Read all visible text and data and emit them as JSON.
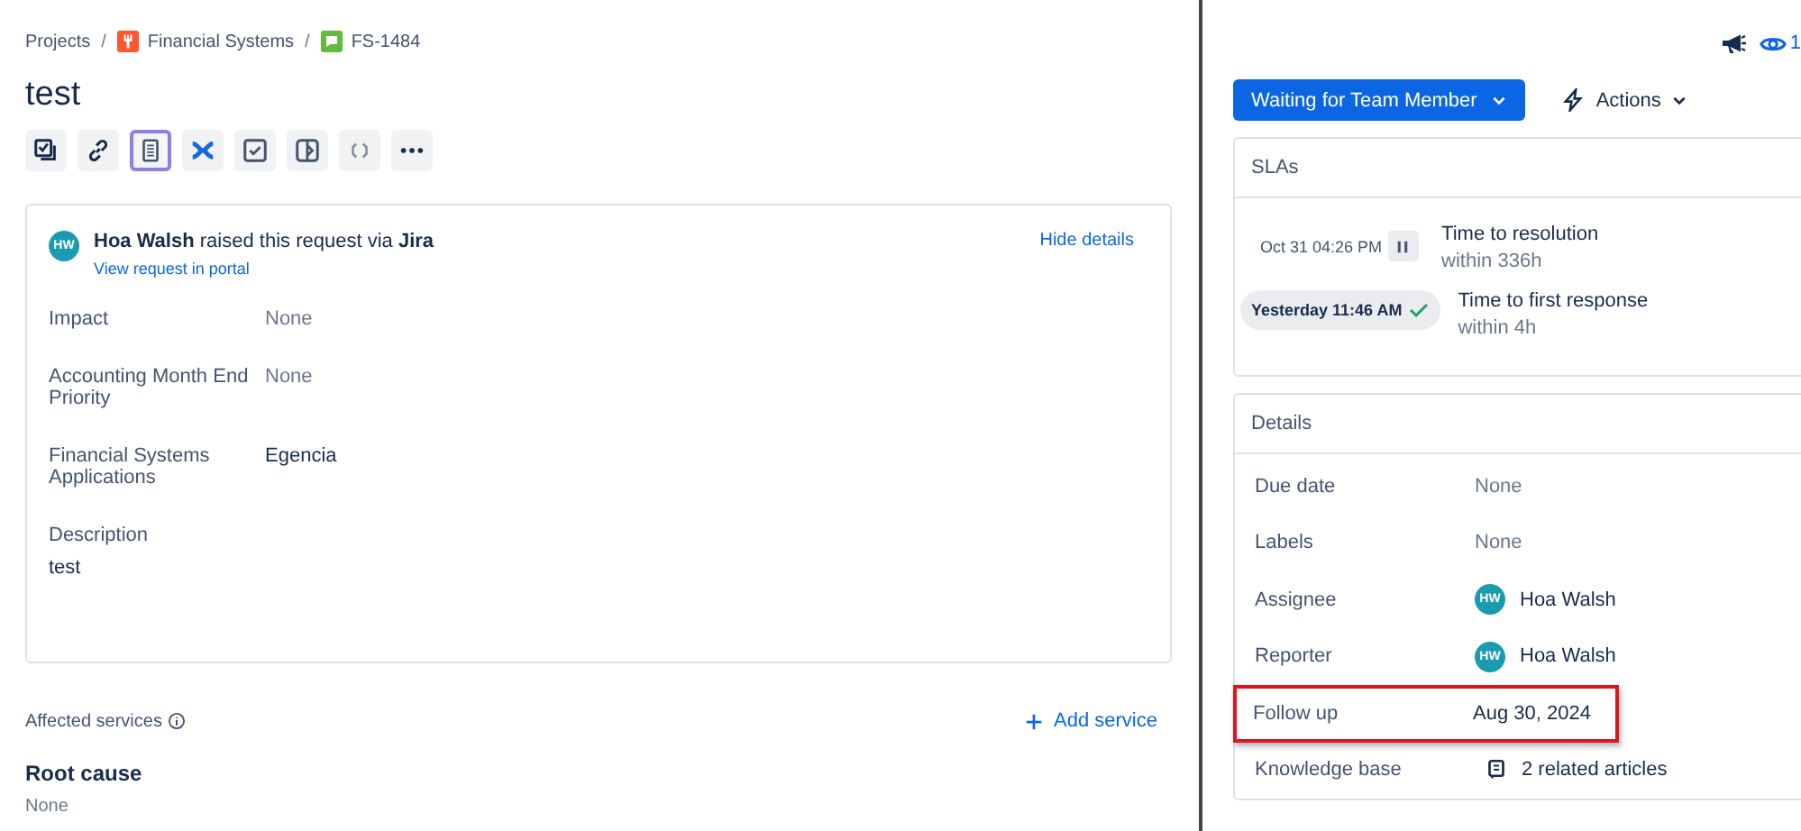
{
  "breadcrumbs": {
    "separator": "/",
    "items": [
      {
        "label": "Projects",
        "kind": "plain"
      },
      {
        "label": "Financial Systems",
        "kind": "project"
      },
      {
        "label": "FS-1484",
        "kind": "issue"
      }
    ]
  },
  "title": "test",
  "toolbar": [
    {
      "selected": false
    },
    {
      "selected": false
    },
    {
      "selected": true
    },
    {
      "selected": false
    },
    {
      "selected": false
    },
    {
      "selected": false
    },
    {
      "selected": false
    },
    {
      "selected": false
    }
  ],
  "request": {
    "avatar": "HW",
    "text": "**Hoa Walsh** raised this request via **Jira**",
    "portal_link": "View request in portal",
    "hide_link": "Hide details",
    "fields": [
      {
        "label": "Impact",
        "value": "None",
        "empty": true
      },
      {
        "label": "Accounting Month End Priority",
        "value": "None",
        "empty": true
      },
      {
        "label": "Financial Systems Applications",
        "value": "Egencia",
        "empty": false
      }
    ],
    "description_label": "Description",
    "description": "test"
  },
  "affected_services": {
    "label": "Affected services",
    "add": "Add service"
  },
  "root_cause": {
    "label": "Root cause",
    "value": "None"
  },
  "header_icons": {
    "watch_count": "1"
  },
  "status_button": "Waiting for Team Member",
  "actions_button": "Actions",
  "slas": {
    "title": "SLAs",
    "items": [
      {
        "kind": "paused",
        "time": "Oct 31 04:26 PM",
        "name": "Time to resolution",
        "goal": "within 336h"
      },
      {
        "kind": "met",
        "time": "Yesterday 11:46 AM",
        "name": "Time to first response",
        "goal": "within 4h"
      }
    ]
  },
  "details": {
    "title": "Details",
    "rows": [
      {
        "label": "Due date",
        "value": "None",
        "kind": "empty",
        "highlighted": false
      },
      {
        "label": "Labels",
        "value": "None",
        "kind": "empty",
        "highlighted": false
      },
      {
        "label": "Assignee",
        "value": "Hoa Walsh",
        "avatar": "HW",
        "kind": "user",
        "highlighted": false
      },
      {
        "label": "Reporter",
        "value": "Hoa Walsh",
        "avatar": "HW",
        "kind": "user",
        "highlighted": false
      },
      {
        "label": "Follow up",
        "value": "Aug 30, 2024",
        "kind": "text",
        "highlighted": true
      },
      {
        "label": "Knowledge base",
        "value": "2 related articles",
        "kind": "articles",
        "highlighted": false
      }
    ]
  }
}
